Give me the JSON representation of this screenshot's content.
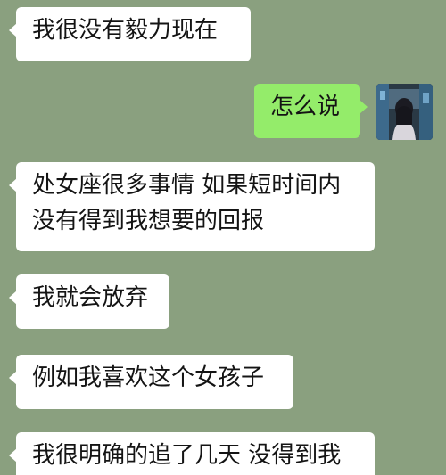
{
  "chat": {
    "messages": [
      {
        "side": "received",
        "text": "我很没有毅力现在"
      },
      {
        "side": "sent",
        "text": "怎么说"
      },
      {
        "side": "received",
        "text": "处女座很多事情 如果短时间内\n没有得到我想要的回报"
      },
      {
        "side": "received",
        "text": "我就会放弃"
      },
      {
        "side": "received",
        "text": "例如我喜欢这个女孩子"
      },
      {
        "side": "received",
        "text": "我很明确的追了几天 没得到我"
      }
    ],
    "avatar": {
      "icon": "user-avatar-photo"
    }
  },
  "colors": {
    "background": "#8aa07f",
    "received_bubble": "#ffffff",
    "sent_bubble": "#94ec6a",
    "text": "#141414"
  }
}
